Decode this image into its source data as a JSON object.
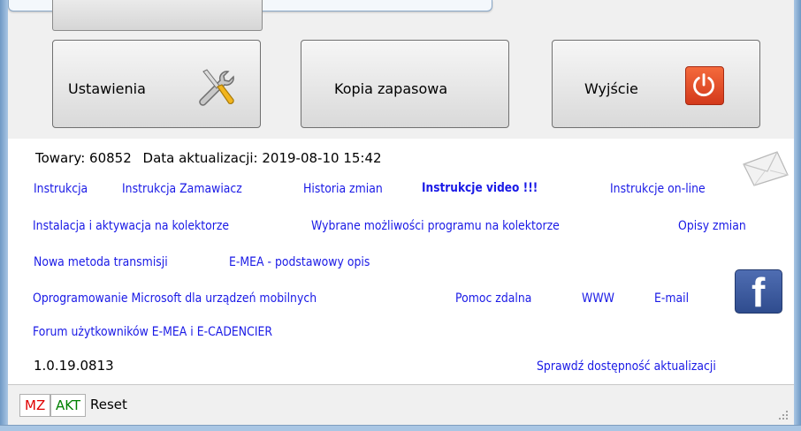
{
  "buttons": {
    "settings": "Ustawienia",
    "backup": "Kopia zapasowa",
    "exit": "Wyjście"
  },
  "info": {
    "products": "Towary: 60852",
    "updated": "Data aktualizacji: 2019-08-10 15:42"
  },
  "links": {
    "instrukcja": "Instrukcja",
    "instrukcja_zamawiacz": "Instrukcja Zamawiacz",
    "historia_zmian": "Historia zmian",
    "instrukcje_video": "Instrukcje video !!!",
    "instrukcje_online": "Instrukcje on-line",
    "instalacja": "Instalacja i aktywacja  na kolektorze",
    "wybrane_mozliwosci": "Wybrane możliwości programu na kolektorze",
    "opisy_zmian": "Opisy zmian",
    "nowa_metoda": "Nowa metoda transmisji",
    "emea_opis": "E-MEA - podstawowy opis",
    "oprogramowanie_ms": "Oprogramowanie Microsoft dla urządzeń mobilnych",
    "pomoc_zdalna": "Pomoc zdalna",
    "www": "WWW",
    "email": "E-mail",
    "forum": "Forum użytkowników E-MEA i E-CADENCIER",
    "sprawdz": "Sprawdź dostępność aktualizacji"
  },
  "version": "1.0.19.0813",
  "status": {
    "mz": "MZ",
    "akt": "AKT",
    "reset": "Reset"
  },
  "icons": {
    "settings": "tools-icon",
    "exit": "power-icon",
    "mail": "mail-icon",
    "facebook": "facebook-icon"
  },
  "colors": {
    "link": "#1a1ae6",
    "mz": "#e00000",
    "akt": "#008000",
    "exit_icon": "#e04a22",
    "facebook": "#3b5998"
  }
}
